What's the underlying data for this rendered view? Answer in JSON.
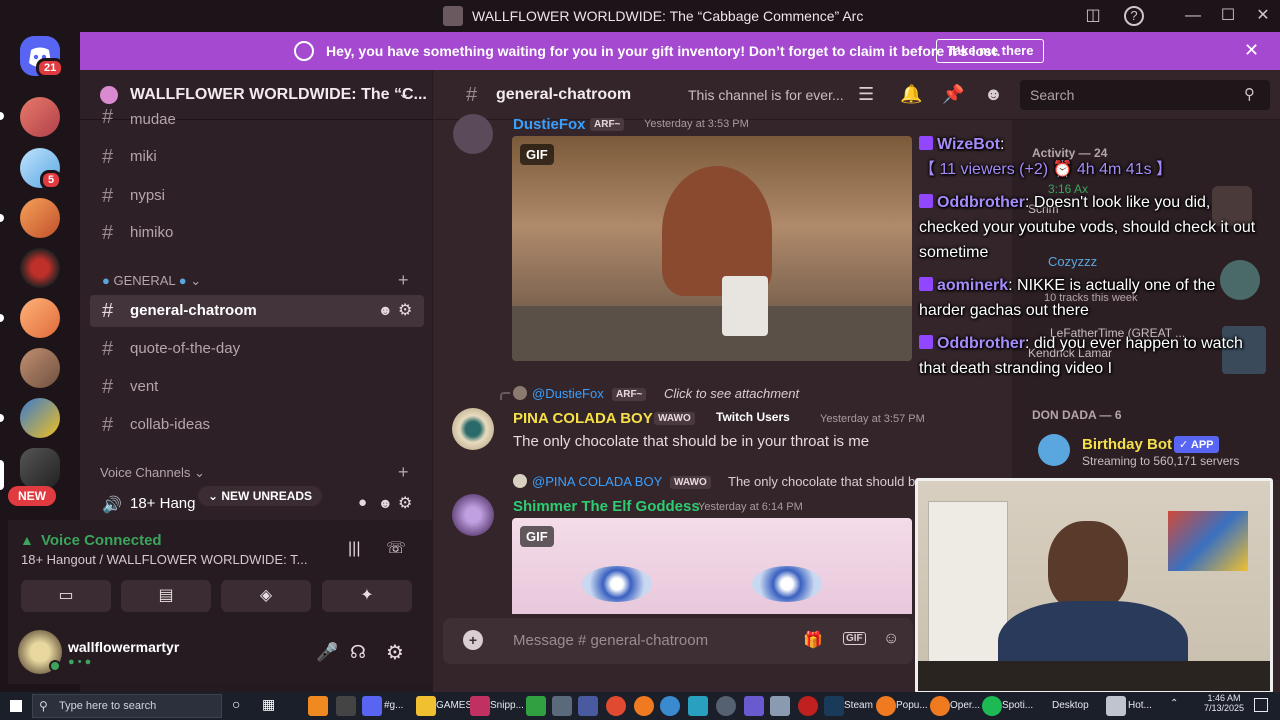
{
  "window": {
    "title": "WALLFLOWER WORLDWIDE: The “Cabbage Commence” Arc"
  },
  "rail": {
    "home_badge": "21",
    "server_badges": [
      "5"
    ],
    "new_label": "NEW"
  },
  "notice": {
    "text": "Hey, you have something waiting for you in your gift inventory! Don’t forget to claim it before it’s lost.",
    "button": "Take me there"
  },
  "guild": {
    "name": "WALLFLOWER WORLDWIDE: The “C..."
  },
  "channels": {
    "top": [
      {
        "label": "mudae"
      },
      {
        "label": "miki"
      },
      {
        "label": "nypsi"
      },
      {
        "label": "himiko"
      }
    ],
    "general_category": "GENERAL",
    "general": [
      {
        "label": "general-chatroom"
      },
      {
        "label": "quote-of-the-day"
      },
      {
        "label": "vent"
      },
      {
        "label": "collab-ideas"
      }
    ],
    "voice_category": "Voice Channels",
    "voice_channel": "18+ Hang",
    "new_unreads": "NEW UNREADS"
  },
  "voice": {
    "status": "Voice Connected",
    "location": "18+ Hangout / WALLFLOWER WORLDWIDE: T..."
  },
  "user": {
    "name": "wallflowermartyr"
  },
  "chat": {
    "channel": "general-chatroom",
    "topic": "This channel is for ever...",
    "search_placeholder": "Search",
    "composer_placeholder": "Message # general-chatroom",
    "messages": [
      {
        "author": "DustieFox",
        "tag": "ARF~",
        "time": "Yesterday at 3:53 PM",
        "gif": "GIF"
      },
      {
        "reply_author": "@DustieFox",
        "reply_tag": "ARF~",
        "reply_text": "Click to see attachment",
        "author": "PINA COLADA BOY",
        "tag": "WAWO",
        "role": "Twitch Users",
        "time": "Yesterday at 3:57 PM",
        "text": "The only chocolate that should be in your throat is me"
      },
      {
        "reply_author": "@PINA COLADA BOY",
        "reply_tag": "WAWO",
        "reply_text": "The only chocolate that should b...",
        "author": "Shimmer The Elf Goddess",
        "time": "Yesterday at 6:14 PM",
        "gif": "GIF"
      }
    ]
  },
  "members": {
    "activity_header": "Activity — 24",
    "activity_items": [
      {
        "time": "3:16 Ax",
        "name": "Scrim"
      },
      {
        "name": "Cozyzzz",
        "sub": "10 tracks this week"
      },
      {
        "name": "LeFatherTime (GREAT ...",
        "sub": "Kendrick Lamar"
      }
    ],
    "section": "DON DADA — 6",
    "bot": {
      "name": "Birthday Bot",
      "badge": "APP",
      "status": "Streaming to 560,171 servers"
    }
  },
  "overlay": [
    {
      "user": "WizeBot",
      "text": "【 11 viewers (+2) ⏰ 4h 4m 41s 】"
    },
    {
      "user": "Oddbrother",
      "text": "Doesn't look like you did, checked your youtube vods, should check it out sometime"
    },
    {
      "user": "aominerk",
      "text": "NIKKE is actually one of the harder gachas out there"
    },
    {
      "user": "Oddbrother",
      "text": "did you ever happen to watch that death stranding video I"
    }
  ],
  "taskbar": {
    "search_placeholder": "Type here to search",
    "labels": [
      "#g...",
      "GAMES",
      "Snipp...",
      "Steam",
      "Popu...",
      "Oper...",
      "Spoti...",
      "Desktop",
      "Hot..."
    ],
    "time": "1:46 AM",
    "date": "7/13/2025"
  },
  "colors": {
    "accent": "#a449d0",
    "author_dustiefox": "#3aa0ff",
    "author_pina": "#f5e04a",
    "author_shimmer": "#2ecc71",
    "voice_connected": "#3ba55c",
    "twitch": "#9146ff"
  }
}
